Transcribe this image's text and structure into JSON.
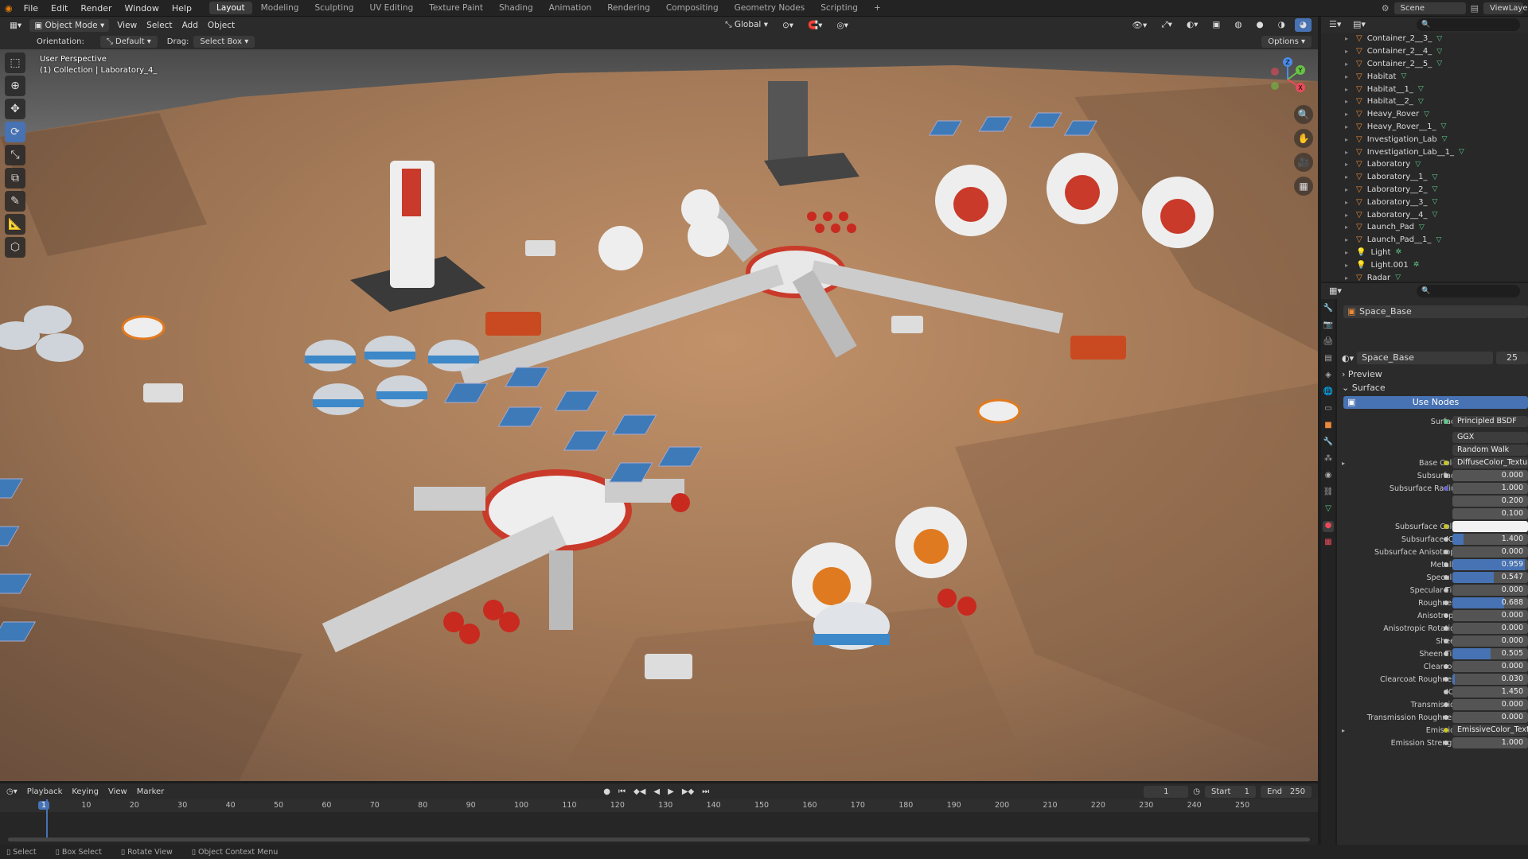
{
  "topbar": {
    "menus": [
      "File",
      "Edit",
      "Render",
      "Window",
      "Help"
    ],
    "workspaces": [
      "Layout",
      "Modeling",
      "Sculpting",
      "UV Editing",
      "Texture Paint",
      "Shading",
      "Animation",
      "Rendering",
      "Compositing",
      "Geometry Nodes",
      "Scripting",
      "+"
    ],
    "active_workspace": "Layout",
    "scene": "Scene",
    "view_layer": "ViewLayer"
  },
  "viewport_header": {
    "mode": "Object Mode",
    "menus": [
      "View",
      "Select",
      "Add",
      "Object"
    ],
    "transform_orientation": "Global"
  },
  "tool_header": {
    "orientation_label": "Orientation:",
    "orientation_value": "Default",
    "drag_label": "Drag:",
    "drag_value": "Select Box",
    "options": "Options"
  },
  "viewport": {
    "perspective": "User Perspective",
    "collection": "(1) Collection | Laboratory_4_",
    "gizmo_axes": [
      "Z",
      "Y",
      "X"
    ]
  },
  "timeline": {
    "menus": [
      "Playback",
      "Keying",
      "View",
      "Marker"
    ],
    "current_frame": "1",
    "start_label": "Start",
    "start": "1",
    "end_label": "End",
    "end": "250",
    "ticks": [
      "1",
      "10",
      "20",
      "30",
      "40",
      "50",
      "60",
      "70",
      "80",
      "90",
      "100",
      "110",
      "120",
      "130",
      "140",
      "150",
      "160",
      "170",
      "180",
      "190",
      "200",
      "210",
      "220",
      "230",
      "240",
      "250"
    ]
  },
  "statusbar": {
    "items": [
      "Select",
      "Box Select",
      "Rotate View",
      "Object Context Menu"
    ]
  },
  "outliner": {
    "items": [
      "Container_2__3_",
      "Container_2__4_",
      "Container_2__5_",
      "Habitat",
      "Habitat__1_",
      "Habitat__2_",
      "Heavy_Rover",
      "Heavy_Rover__1_",
      "Investigation_Lab",
      "Investigation_Lab__1_",
      "Laboratory",
      "Laboratory__1_",
      "Laboratory__2_",
      "Laboratory__3_",
      "Laboratory__4_",
      "Launch_Pad",
      "Launch_Pad__1_",
      "Light",
      "Light.001",
      "Radar"
    ]
  },
  "properties": {
    "object_name": "Space_Base",
    "material_name": "Space_Base",
    "users": "25",
    "preview_label": "Preview",
    "surface_section": "Surface",
    "use_nodes": "Use Nodes",
    "surface_label": "Surface",
    "surface_value": "Principled BSDF",
    "distribution": "GGX",
    "subsurface_method": "Random Walk",
    "rows": [
      {
        "label": "Base Color",
        "value": "DiffuseColor_Texture",
        "kind": "link"
      },
      {
        "label": "Subsurface",
        "value": "0.000",
        "kind": "num",
        "fill": 0
      },
      {
        "label": "Subsurface Radius",
        "value": "1.000",
        "kind": "num",
        "fill": 0
      },
      {
        "label": "",
        "value": "0.200",
        "kind": "num",
        "fill": 0
      },
      {
        "label": "",
        "value": "0.100",
        "kind": "num",
        "fill": 0
      },
      {
        "label": "Subsurface Color",
        "value": "",
        "kind": "color"
      },
      {
        "label": "Subsurface IOR",
        "value": "1.400",
        "kind": "num",
        "fill": 0.15
      },
      {
        "label": "Subsurface Anisotropy",
        "value": "0.000",
        "kind": "num",
        "fill": 0
      },
      {
        "label": "Metallic",
        "value": "0.959",
        "kind": "num",
        "fill": 0.959
      },
      {
        "label": "Specular",
        "value": "0.547",
        "kind": "num",
        "fill": 0.547
      },
      {
        "label": "Specular Tint",
        "value": "0.000",
        "kind": "num",
        "fill": 0
      },
      {
        "label": "Roughness",
        "value": "0.688",
        "kind": "num",
        "fill": 0.688
      },
      {
        "label": "Anisotropic",
        "value": "0.000",
        "kind": "num",
        "fill": 0
      },
      {
        "label": "Anisotropic Rotation",
        "value": "0.000",
        "kind": "num",
        "fill": 0
      },
      {
        "label": "Sheen",
        "value": "0.000",
        "kind": "num",
        "fill": 0
      },
      {
        "label": "Sheen Tint",
        "value": "0.505",
        "kind": "num",
        "fill": 0.505
      },
      {
        "label": "Clearcoat",
        "value": "0.000",
        "kind": "num",
        "fill": 0
      },
      {
        "label": "Clearcoat Roughness",
        "value": "0.030",
        "kind": "num",
        "fill": 0.03
      },
      {
        "label": "IOR",
        "value": "1.450",
        "kind": "num",
        "fill": 0
      },
      {
        "label": "Transmission",
        "value": "0.000",
        "kind": "num",
        "fill": 0
      },
      {
        "label": "Transmission Roughness",
        "value": "0.000",
        "kind": "num",
        "fill": 0
      },
      {
        "label": "Emission",
        "value": "EmissiveColor_Texture",
        "kind": "link"
      },
      {
        "label": "Emission Strength",
        "value": "1.000",
        "kind": "num",
        "fill": 0
      }
    ]
  },
  "colors": {
    "accent": "#4772b3",
    "object_icon": "#e88a3a",
    "data_icon": "#5fc88a"
  }
}
